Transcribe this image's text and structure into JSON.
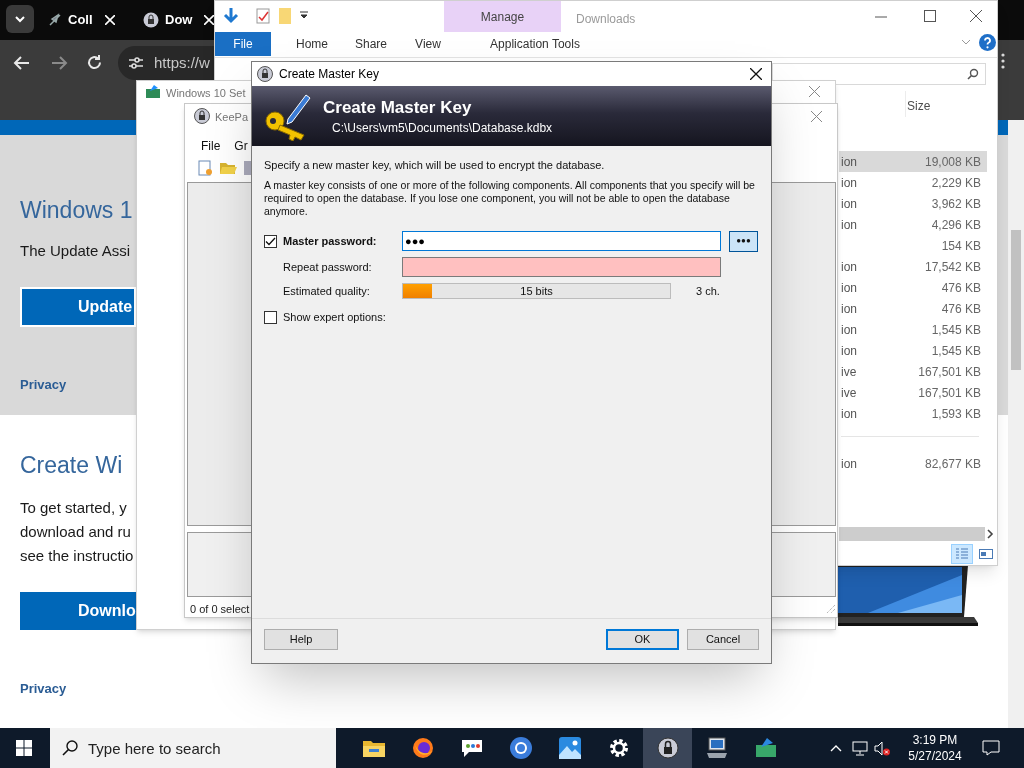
{
  "browser": {
    "tabs": [
      {
        "title": "Coll",
        "kind": "feather"
      },
      {
        "title": "Dow",
        "kind": "lock"
      }
    ],
    "url": "https://w",
    "page": {
      "hero_title": "Windows 1",
      "hero_text": "The Update Assi",
      "update_button": "Update",
      "privacy_1": "Privacy",
      "section_title": "Create Wi",
      "section_lines": [
        "To get started, y",
        "download and ru",
        "see the instructio"
      ],
      "download_button": "Downlo",
      "privacy_2": "Privacy"
    }
  },
  "explorer": {
    "title": "Downloads",
    "contextual_tab": "Manage",
    "ribbon_tabs": [
      {
        "label": "File",
        "kind": "file"
      },
      {
        "label": "Home",
        "kind": "tab"
      },
      {
        "label": "Share",
        "kind": "tab"
      },
      {
        "label": "View",
        "kind": "tab"
      },
      {
        "label": "Application Tools",
        "kind": "contextual"
      }
    ],
    "columns": [
      "Size"
    ],
    "groups": [
      {
        "rows": [
          {
            "column_1": "ion",
            "size": "19,008 KB",
            "selected": true
          },
          {
            "column_1": "ion",
            "size": "2,229 KB",
            "selected": false
          },
          {
            "column_1": "ion",
            "size": "3,962 KB",
            "selected": false
          },
          {
            "column_1": "ion",
            "size": "4,296 KB",
            "selected": false
          },
          {
            "size": "154 KB",
            "selected": false
          },
          {
            "column_1": "ion",
            "size": "17,542 KB",
            "selected": false
          },
          {
            "column_1": "ion",
            "size": "476 KB",
            "selected": false
          },
          {
            "column_1": "ion",
            "size": "476 KB",
            "selected": false
          },
          {
            "column_1": "ion",
            "size": "1,545 KB",
            "selected": false
          },
          {
            "column_1": "ion",
            "size": "1,545 KB",
            "selected": false
          },
          {
            "column_1": "ive",
            "size": "167,501 KB",
            "selected": false
          },
          {
            "column_1": "ive",
            "size": "167,501 KB",
            "selected": false
          },
          {
            "column_1": "ion",
            "size": "1,593 KB",
            "selected": false
          }
        ]
      },
      {
        "rows": [
          {
            "column_1": "ion",
            "size": "82,677 KB",
            "selected": false
          }
        ]
      }
    ],
    "view_buttons": [
      {
        "kind": "details",
        "selected": true
      },
      {
        "kind": "tiles",
        "selected": false
      }
    ]
  },
  "setup_window": {
    "title": "Windows 10 Set"
  },
  "keepass_window": {
    "title": "KeePa",
    "menu": [
      "File",
      "Gr"
    ],
    "status": "0 of 0 select"
  },
  "dialog": {
    "title": "Create Master Key",
    "banner_title": "Create Master Key",
    "banner_path": "C:\\Users\\vm5\\Documents\\Database.kdbx",
    "intro": "Specify a new master key, which will be used to encrypt the database.",
    "description": "A master key consists of one or more of the following components. All components that you specify will be required to open the database. If you lose one component, you will not be able to open the database anymore.",
    "master_password": {
      "label": "Master password:",
      "checked": true,
      "value": "●●●",
      "reveal_button": "●●●"
    },
    "repeat_password": {
      "label": "Repeat password:",
      "mismatch": true
    },
    "quality": {
      "label": "Estimated quality:",
      "level": 0.11,
      "reading": "15 bits",
      "chars": "3 ch."
    },
    "expert_options": {
      "label": "Show expert options:",
      "checked": false
    },
    "buttons": [
      {
        "label": "Help",
        "kind": "help"
      },
      {
        "label": "OK",
        "kind": "default"
      },
      {
        "label": "Cancel",
        "kind": "normal"
      }
    ]
  },
  "taskbar": {
    "search_placeholder": "Type here to search",
    "apps": [
      {
        "kind": "folder",
        "selected": false
      },
      {
        "kind": "firefox",
        "selected": false
      },
      {
        "kind": "chat",
        "selected": false
      },
      {
        "kind": "browser",
        "selected": false
      },
      {
        "kind": "photos",
        "selected": false
      },
      {
        "kind": "settings",
        "selected": false
      },
      {
        "kind": "keepass",
        "selected": true
      },
      {
        "kind": "computer",
        "selected": false
      },
      {
        "kind": "setup",
        "selected": false
      }
    ],
    "time": "3:19 PM",
    "date": "5/27/2024"
  }
}
